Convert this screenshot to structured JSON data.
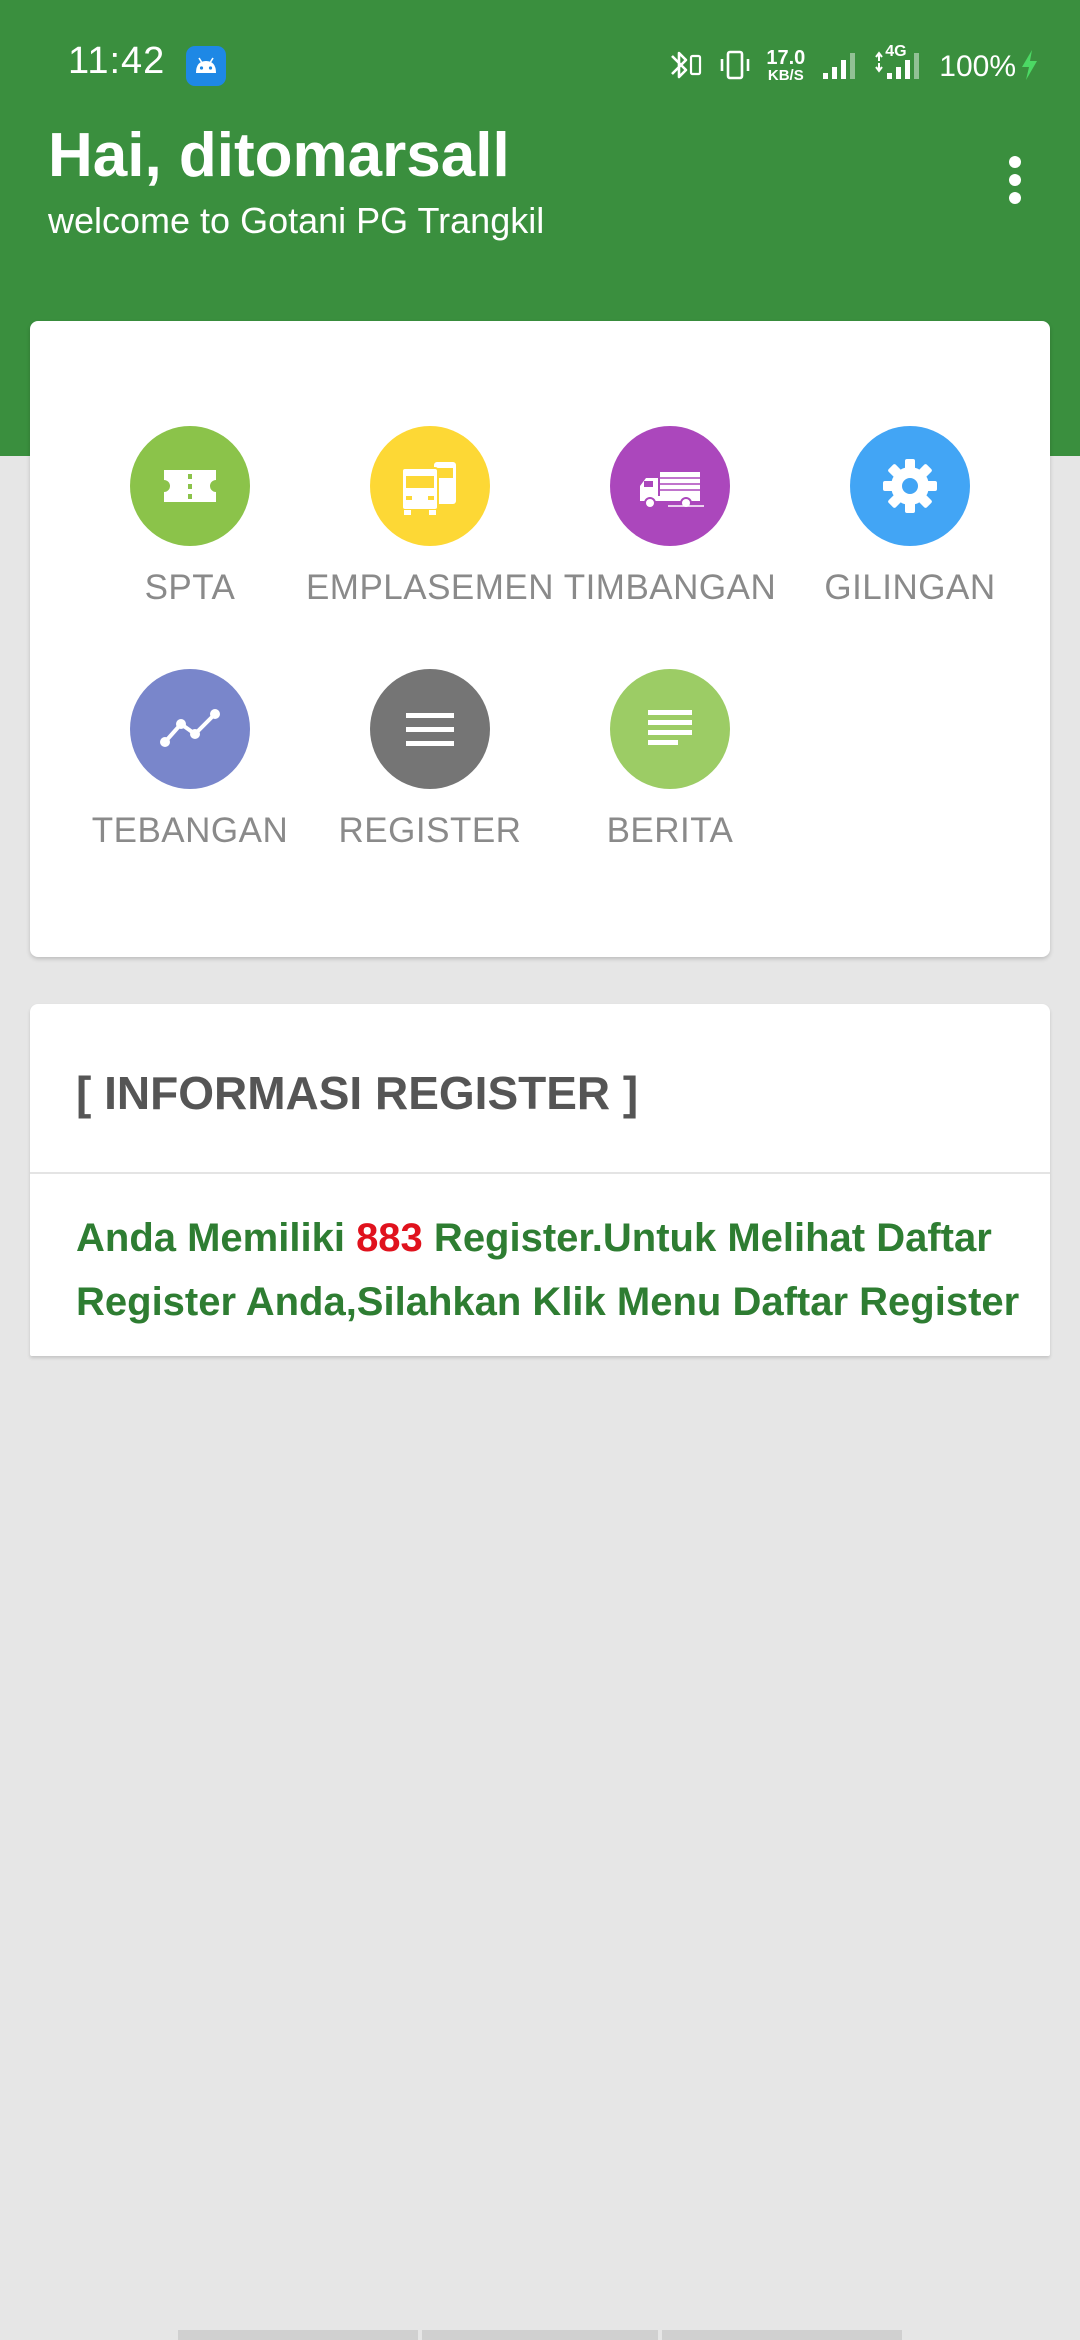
{
  "status_bar": {
    "time": "11:42",
    "net_speed_value": "17.0",
    "net_speed_unit": "KB/S",
    "network_label": "4G",
    "battery": "100%"
  },
  "header": {
    "greeting": "Hai, ditomarsall",
    "welcome": "welcome to Gotani PG Trangkil",
    "background_color": "#3a8f3e"
  },
  "menu": {
    "items": [
      {
        "label": "SPTA",
        "icon": "ticket-icon",
        "color": "#8bc34a"
      },
      {
        "label": "EMPLASEMEN",
        "icon": "trucks-icon",
        "color": "#fdd835"
      },
      {
        "label": "TIMBANGAN",
        "icon": "delivery-truck-icon",
        "color": "#ab47bc"
      },
      {
        "label": "GILINGAN",
        "icon": "gear-icon",
        "color": "#42a5f5"
      },
      {
        "label": "TEBANGAN",
        "icon": "trend-line-icon",
        "color": "#7986cb"
      },
      {
        "label": "REGISTER",
        "icon": "menu-lines-icon",
        "color": "#757575"
      },
      {
        "label": "BERITA",
        "icon": "article-icon",
        "color": "#9ccc65"
      }
    ]
  },
  "info": {
    "title": "[ INFORMASI REGISTER ]",
    "text_before": "Anda Memiliki ",
    "count": "883",
    "text_after": " Register.Untuk Melihat Daftar Register Anda,Silahkan Klik Menu Daftar Register"
  }
}
